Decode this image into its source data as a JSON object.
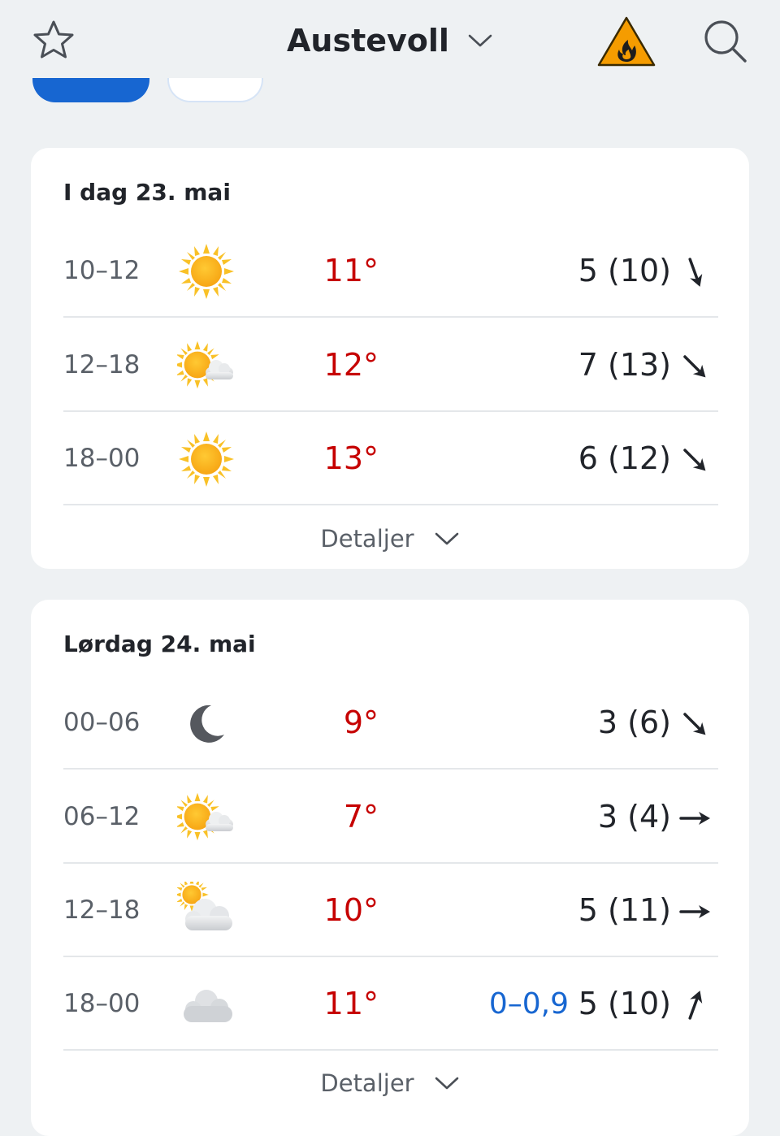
{
  "header": {
    "location": "Austevoll",
    "icons": {
      "favorite": "star-outline-icon",
      "location_dropdown": "chevron-down-icon",
      "warning": "fire-warning-icon",
      "search": "search-icon"
    },
    "warning_color": "#f59c00"
  },
  "colors": {
    "accent": "#1766d1",
    "temp_warm": "#c60000",
    "precip": "#1766d1",
    "background": "#eef1f3"
  },
  "days": [
    {
      "title": "I dag 23. mai",
      "details_label": "Detaljer",
      "rows": [
        {
          "time": "10–12",
          "icon": "sun-icon",
          "temp": "11°",
          "precip": "",
          "wind": "5 (10)",
          "wind_dir": "south",
          "wind_dir_deg": 170
        },
        {
          "time": "12–18",
          "icon": "partly-cloudy-icon",
          "temp": "12°",
          "precip": "",
          "wind": "7 (13)",
          "wind_dir": "southeast",
          "wind_dir_deg": 135
        },
        {
          "time": "18–00",
          "icon": "sun-icon",
          "temp": "13°",
          "precip": "",
          "wind": "6 (12)",
          "wind_dir": "southeast",
          "wind_dir_deg": 135
        }
      ]
    },
    {
      "title": "Lørdag 24. mai",
      "details_label": "Detaljer",
      "rows": [
        {
          "time": "00–06",
          "icon": "moon-icon",
          "temp": "9°",
          "precip": "",
          "wind": "3 (6)",
          "wind_dir": "southeast",
          "wind_dir_deg": 135
        },
        {
          "time": "06–12",
          "icon": "partly-cloudy-icon",
          "temp": "7°",
          "precip": "",
          "wind": "3 (4)",
          "wind_dir": "east",
          "wind_dir_deg": 90
        },
        {
          "time": "12–18",
          "icon": "cloudy-sun-icon",
          "temp": "10°",
          "precip": "",
          "wind": "5 (11)",
          "wind_dir": "east",
          "wind_dir_deg": 90
        },
        {
          "time": "18–00",
          "icon": "cloud-icon",
          "temp": "11°",
          "precip": "0–0,9",
          "wind": "5 (10)",
          "wind_dir": "northeast",
          "wind_dir_deg": 20
        }
      ]
    }
  ]
}
